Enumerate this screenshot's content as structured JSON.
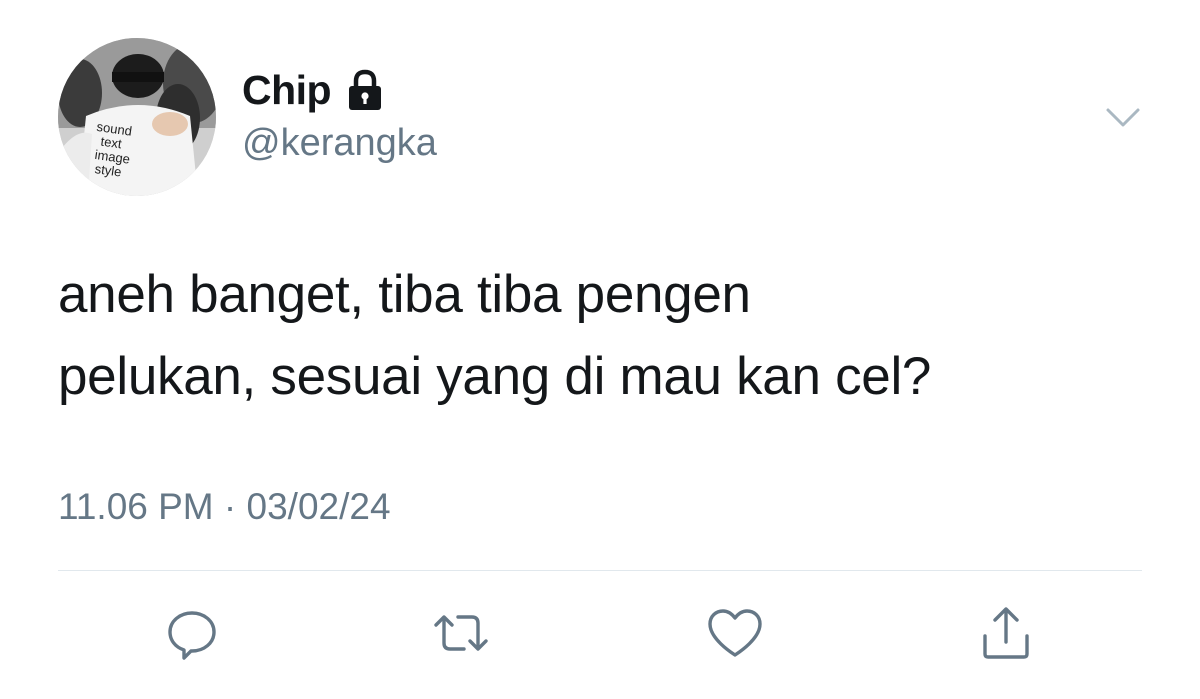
{
  "user": {
    "display_name": "Chip",
    "handle": "@kerangka",
    "protected_icon": "lock-icon",
    "avatar_shirt_text": [
      "sound",
      "text",
      "image",
      "style"
    ]
  },
  "tweet": {
    "text_lines": [
      "aneh banget, tiba tiba pengen",
      "pelukan, sesuai yang di mau kan cel?"
    ],
    "timestamp": "11.06 PM · 03/02/24"
  },
  "actions": {
    "more_icon": "chevron-down-icon",
    "reply_icon": "reply-icon",
    "retweet_icon": "retweet-icon",
    "like_icon": "heart-icon",
    "share_icon": "share-icon"
  },
  "colors": {
    "text_primary": "#14171a",
    "text_secondary": "#657786",
    "icon_gray": "#657786",
    "divider": "#e1e8ed"
  }
}
